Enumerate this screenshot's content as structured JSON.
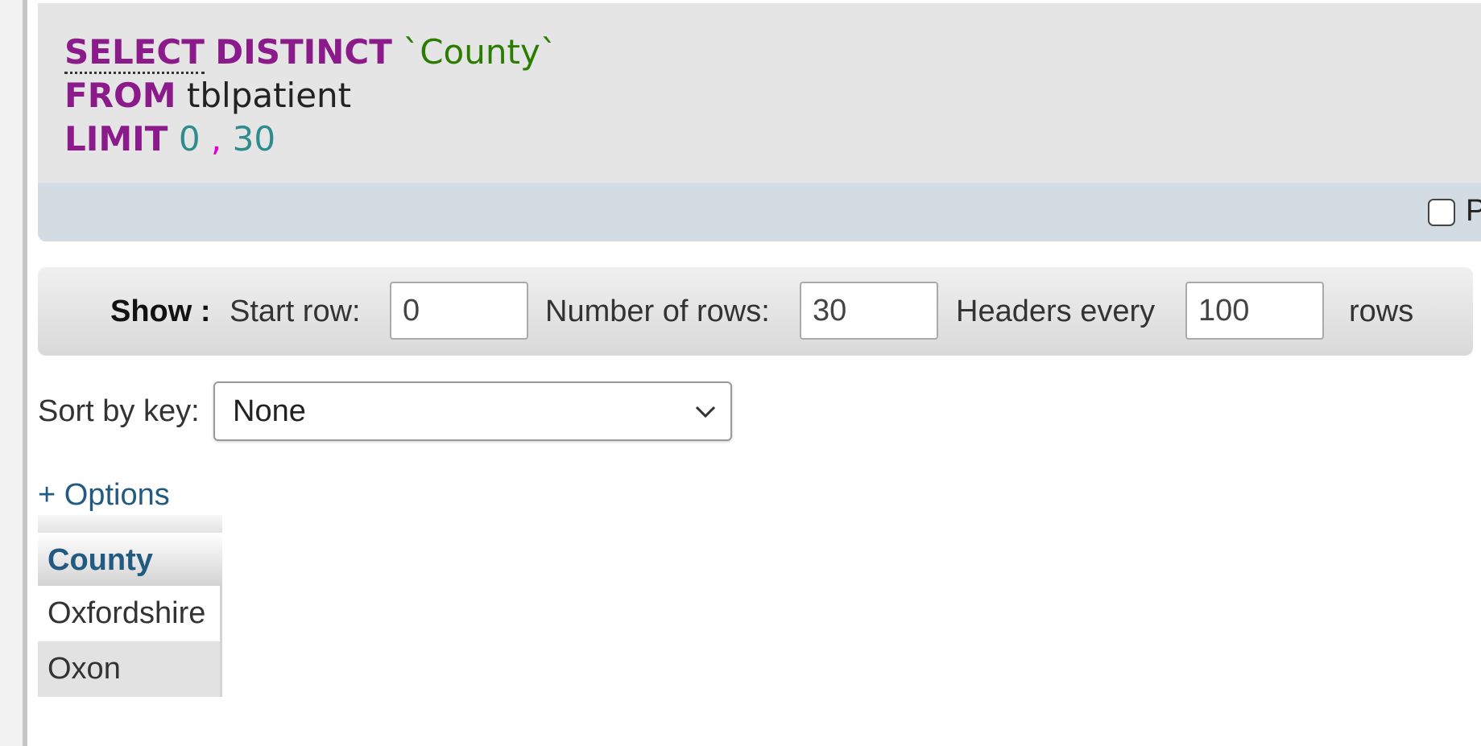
{
  "sql_query": {
    "lines": [
      {
        "keyword": "SELECT",
        "keyword2": "DISTINCT",
        "column": "`County`"
      },
      {
        "keyword": "FROM",
        "table": "tblpatient"
      },
      {
        "keyword": "LIMIT",
        "start": "0",
        "separator": ",",
        "count": "30"
      }
    ]
  },
  "sql_actions": {
    "profiling_label": "P",
    "profiling_checked": false
  },
  "navigation": {
    "show_label": "Show :",
    "start_row_label": "Start row:",
    "start_row_value": "0",
    "number_of_rows_label": "Number of rows:",
    "number_of_rows_value": "30",
    "headers_every_label": "Headers every",
    "headers_every_value": "100",
    "rows_suffix": "rows"
  },
  "sort": {
    "label": "Sort by key:",
    "selected": "None"
  },
  "options_link": "+ Options",
  "result_table": {
    "columns": [
      "County"
    ],
    "rows": [
      "Oxfordshire",
      "Oxon"
    ]
  },
  "icons": {
    "dropdown": "chevron-down-icon"
  }
}
